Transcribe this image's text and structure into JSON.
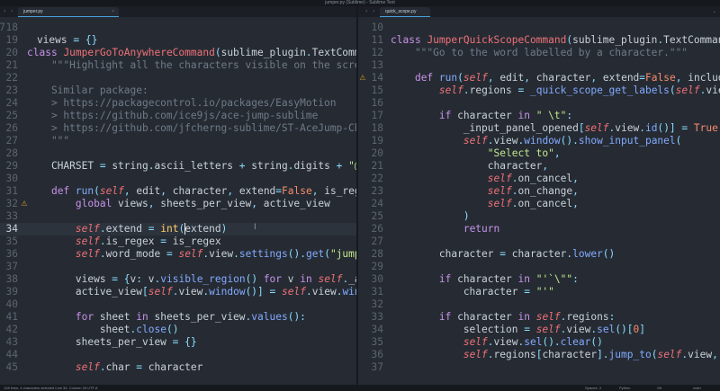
{
  "window": {
    "title": "jumper.py (Sublime) - Sublime Text"
  },
  "left_pane": {
    "tab": {
      "name": "jumper.py",
      "close": "×"
    },
    "partial_top": "    views = {}",
    "lines": [
      {
        "n": "18",
        "text": ""
      },
      {
        "n": "19",
        "text": ""
      },
      {
        "n": "20",
        "text": "class JumperGoToAnywhereCommand(sublime_plugin.TextCommand):"
      },
      {
        "n": "21",
        "text": "    \"\"\"Highlight all the characters visible on the screen, wi"
      },
      {
        "n": "22",
        "text": ""
      },
      {
        "n": "23",
        "text": "    Similar package:"
      },
      {
        "n": "24",
        "text": "    > https://packagecontrol.io/packages/EasyMotion"
      },
      {
        "n": "25",
        "text": "    > https://github.com/ice9js/ace-jump-sublime"
      },
      {
        "n": "26",
        "text": "    > https://github.com/jfcherng-sublime/ST-AceJump-Chinese"
      },
      {
        "n": "27",
        "text": "    \"\"\""
      },
      {
        "n": "28",
        "text": ""
      },
      {
        "n": "29",
        "text": "    CHARSET = string.ascii_letters + string.digits + \"@%${}&!#"
      },
      {
        "n": "30",
        "text": ""
      },
      {
        "n": "31",
        "text": "    def run(self, edit, character, extend=False, is_regex=Fals"
      },
      {
        "n": "32",
        "text": "        global views, sheets_per_view, active_view"
      },
      {
        "n": "33",
        "text": ""
      },
      {
        "n": "34",
        "text": "        self.extend = int(extend)"
      },
      {
        "n": "35",
        "text": "        self.is_regex = is_regex"
      },
      {
        "n": "36",
        "text": "        self.word_mode = self.view.settings().get(\"jumper_go_t"
      },
      {
        "n": "37",
        "text": ""
      },
      {
        "n": "38",
        "text": "        views = {v: v.visible_region() for v in self._active_v"
      },
      {
        "n": "39",
        "text": "        active_view[self.view.window()] = self.view.window().a"
      },
      {
        "n": "40",
        "text": ""
      },
      {
        "n": "41",
        "text": "        for sheet in sheets_per_view.values():"
      },
      {
        "n": "42",
        "text": "            sheet.close()"
      },
      {
        "n": "43",
        "text": "        sheets_per_view = {}"
      },
      {
        "n": "44",
        "text": ""
      },
      {
        "n": "45",
        "text": "        self.char = character"
      }
    ]
  },
  "right_pane": {
    "tab": {
      "name": "quick_scope.py",
      "close": "×"
    },
    "lines": [
      {
        "n": "10",
        "text": ""
      },
      {
        "n": "11",
        "text": "class JumperQuickScopeCommand(sublime_plugin.TextCommand):"
      },
      {
        "n": "12",
        "text": "    \"\"\"Go to the word labelled by a character.\"\"\""
      },
      {
        "n": "13",
        "text": ""
      },
      {
        "n": "14",
        "text": "    def run(self, edit, character, extend=False, included=True"
      },
      {
        "n": "15",
        "text": "        self.regions = _quick_scope_get_labels(self.view)"
      },
      {
        "n": "16",
        "text": ""
      },
      {
        "n": "17",
        "text": "        if character in \" \\t\":"
      },
      {
        "n": "18",
        "text": "            _input_panel_opened[self.view.id()] = True"
      },
      {
        "n": "19",
        "text": "            self.view.window().show_input_panel("
      },
      {
        "n": "20",
        "text": "                \"Select to\","
      },
      {
        "n": "21",
        "text": "                character,"
      },
      {
        "n": "22",
        "text": "                self.on_cancel,"
      },
      {
        "n": "23",
        "text": "                self.on_change,"
      },
      {
        "n": "24",
        "text": "                self.on_cancel,"
      },
      {
        "n": "25",
        "text": "            )"
      },
      {
        "n": "26",
        "text": "            return"
      },
      {
        "n": "27",
        "text": ""
      },
      {
        "n": "28",
        "text": "        character = character.lower()"
      },
      {
        "n": "29",
        "text": ""
      },
      {
        "n": "30",
        "text": "        if character in \"'`\\\"\":"
      },
      {
        "n": "31",
        "text": "            character = \"'\""
      },
      {
        "n": "32",
        "text": ""
      },
      {
        "n": "33",
        "text": "        if character in self.regions:"
      },
      {
        "n": "34",
        "text": "            selection = self.view.sel()[0]"
      },
      {
        "n": "35",
        "text": "            self.view.sel().clear()"
      },
      {
        "n": "36",
        "text": "            self.regions[character].jump_to(self.view, selecti"
      },
      {
        "n": "37",
        "text": ""
      }
    ]
  },
  "statusbar": {
    "left": "128 lines, 4 characters selected   Line 34, Column 26   UTF-8",
    "right": [
      "Spaces: 4",
      "Python",
      "Git",
      "main"
    ]
  },
  "colors": {
    "background": "#262b33",
    "gutter_text": "#5b6470",
    "keyword": "#c792ea",
    "class_name": "#f07178",
    "string": "#c3e88d",
    "comment": "#6f7a88"
  }
}
